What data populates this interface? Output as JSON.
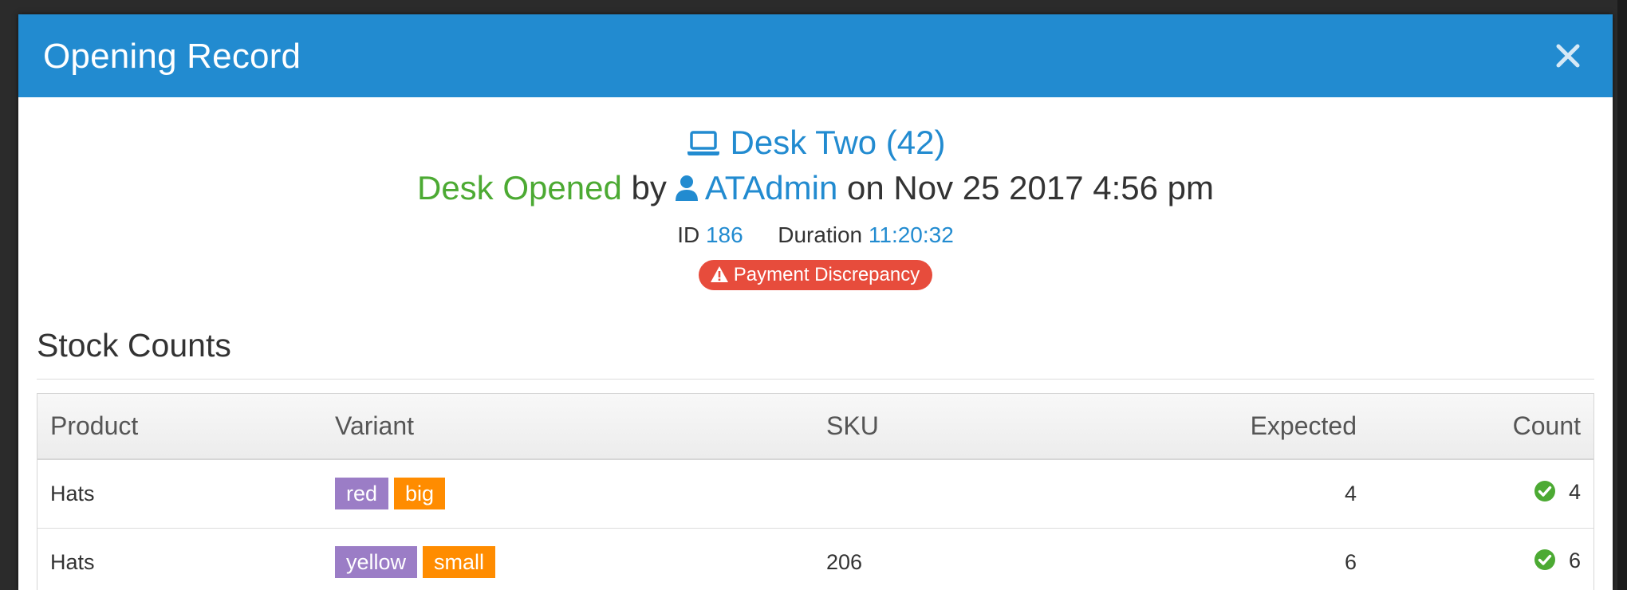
{
  "modal": {
    "title": "Opening Record",
    "close_label": "×"
  },
  "summary": {
    "desk_name": "Desk Two (42)",
    "status": "Desk Opened",
    "by_label": "by",
    "user": "ATAdmin",
    "on_label": "on Nov 25 2017 4:56 pm",
    "id_label": "ID",
    "id_value": "186",
    "duration_label": "Duration",
    "duration_value": "11:20:32",
    "badge": "Payment Discrepancy"
  },
  "stock": {
    "section_title": "Stock Counts",
    "columns": {
      "product": "Product",
      "variant": "Variant",
      "sku": "SKU",
      "expected": "Expected",
      "count": "Count"
    },
    "rows": [
      {
        "product": "Hats",
        "tags": [
          "red",
          "big"
        ],
        "sku": "",
        "expected": "4",
        "count": "4"
      },
      {
        "product": "Hats",
        "tags": [
          "yellow",
          "small"
        ],
        "sku": "206",
        "expected": "6",
        "count": "6"
      }
    ]
  },
  "colors": {
    "header_blue": "#228bd0",
    "status_green": "#4caa33",
    "badge_red": "#e74c3c",
    "tag_purple": "#9b7dc6",
    "tag_orange": "#ff8c00"
  },
  "icons": {
    "desk": "laptop-icon",
    "user": "user-icon",
    "badge": "warning-icon",
    "count_ok": "check-circle-icon"
  }
}
